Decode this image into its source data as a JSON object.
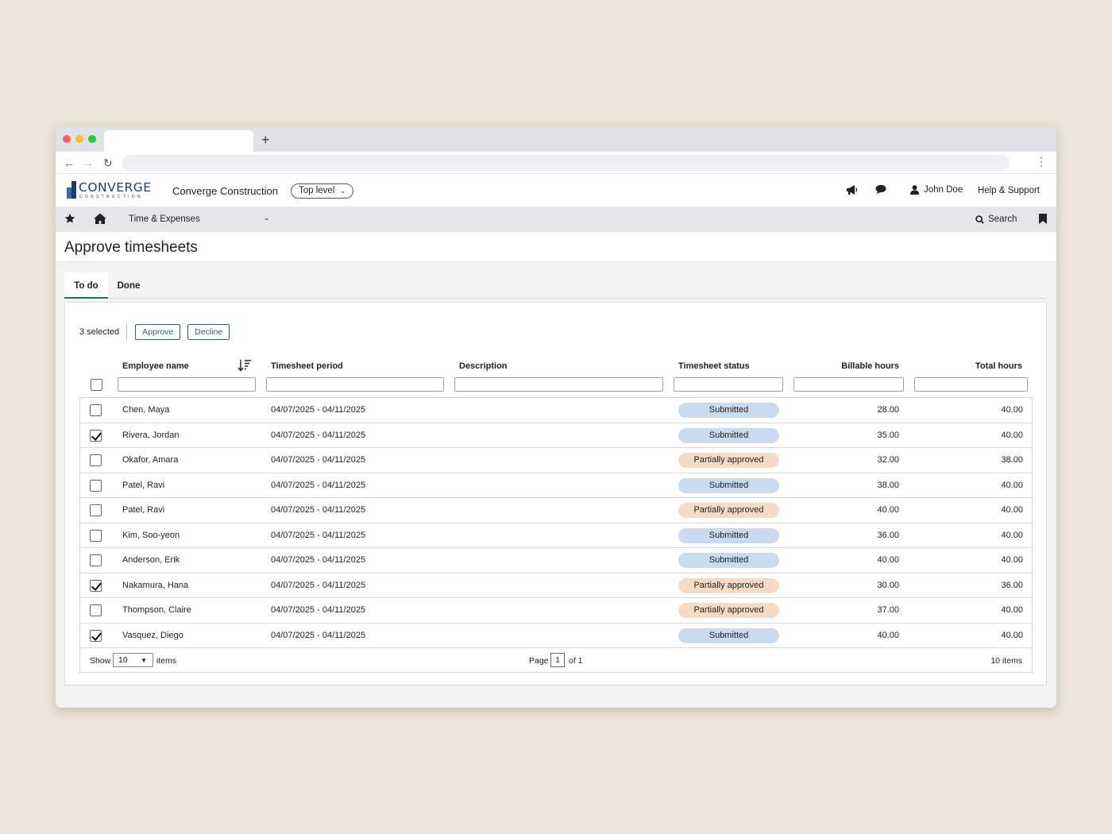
{
  "brand": {
    "logo_text": "CONVERGE",
    "logo_sub": "CONSTRUCTION",
    "company": "Converge Construction",
    "level": "Top level"
  },
  "header": {
    "user": "John Doe",
    "help": "Help & Support"
  },
  "nav": {
    "module": "Time & Expenses",
    "search": "Search"
  },
  "page": {
    "title": "Approve timesheets"
  },
  "tabs": [
    {
      "label": "To do"
    },
    {
      "label": "Done"
    }
  ],
  "toolbar": {
    "selected": "3 selected",
    "approve": "Approve",
    "decline": "Decline"
  },
  "columns": [
    "Employee name",
    "Timesheet period",
    "Description",
    "Timesheet status",
    "Billable hours",
    "Total hours"
  ],
  "rows": [
    {
      "name": "Chen, Maya",
      "period": "04/07/2025 - 04/11/2025",
      "desc": "",
      "status": "Submitted",
      "billable": "28.00",
      "total": "40.00",
      "checked": false
    },
    {
      "name": "Rivera, Jordan",
      "period": "04/07/2025 - 04/11/2025",
      "desc": "",
      "status": "Submitted",
      "billable": "35.00",
      "total": "40.00",
      "checked": true
    },
    {
      "name": "Okafor, Amara",
      "period": "04/07/2025 - 04/11/2025",
      "desc": "",
      "status": "Partially approved",
      "billable": "32.00",
      "total": "38.00",
      "checked": false
    },
    {
      "name": "Patel, Ravi",
      "period": "04/07/2025 - 04/11/2025",
      "desc": "",
      "status": "Submitted",
      "billable": "38.00",
      "total": "40.00",
      "checked": false
    },
    {
      "name": "Patel, Ravi",
      "period": "04/07/2025 - 04/11/2025",
      "desc": "",
      "status": "Partially approved",
      "billable": "40.00",
      "total": "40.00",
      "checked": false
    },
    {
      "name": "Kim, Soo-yeon",
      "period": "04/07/2025 - 04/11/2025",
      "desc": "",
      "status": "Submitted",
      "billable": "36.00",
      "total": "40.00",
      "checked": false
    },
    {
      "name": "Anderson, Erik",
      "period": "04/07/2025 - 04/11/2025",
      "desc": "",
      "status": "Submitted",
      "billable": "40.00",
      "total": "40.00",
      "checked": false
    },
    {
      "name": "Nakamura, Hana",
      "period": "04/07/2025 - 04/11/2025",
      "desc": "",
      "status": "Partially approved",
      "billable": "30.00",
      "total": "36.00",
      "checked": true
    },
    {
      "name": "Thompson, Claire",
      "period": "04/07/2025 - 04/11/2025",
      "desc": "",
      "status": "Partially approved",
      "billable": "37.00",
      "total": "40.00",
      "checked": false
    },
    {
      "name": "Vasquez, Diego",
      "period": "04/07/2025 - 04/11/2025",
      "desc": "",
      "status": "Submitted",
      "billable": "40.00",
      "total": "40.00",
      "checked": true
    }
  ],
  "pager": {
    "show_label": "Show",
    "page_size": "10",
    "items_label": "items",
    "page_label": "Page",
    "page": "1",
    "of_label": "of 1",
    "total": "10 items"
  },
  "colors": {
    "accent": "#2b6e4e",
    "button": "#2d5f7e",
    "submitted": "#c9dbee",
    "partial": "#f6dcc4"
  }
}
